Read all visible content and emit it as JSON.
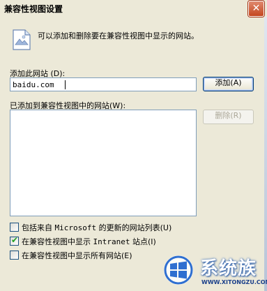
{
  "window": {
    "title": "兼容性视图设置",
    "close_glyph": "✕"
  },
  "info": {
    "text": "可以添加和删除要在兼容性视图中显示的网站。",
    "icon": "document-icon"
  },
  "add_site": {
    "label": "添加此网站",
    "label_key": "(D):",
    "value": "baidu.com",
    "button_label": "添加(A)"
  },
  "added_sites": {
    "label": "已添加到兼容性视图中的网站",
    "label_key": "(W):",
    "items": [],
    "delete_label": "删除(R)"
  },
  "options": [
    {
      "prefix": "包括来自 ",
      "mono": "Microsoft",
      "suffix": " 的更新的网站列表(U)",
      "checked": false
    },
    {
      "prefix": "在兼容性视图中显示 ",
      "mono": "Intranet",
      "suffix": " 站点(I)",
      "checked": true
    },
    {
      "prefix": "在兼容性视图中显示所有网站(E)",
      "mono": "",
      "suffix": "",
      "checked": false
    }
  ],
  "watermark": {
    "text": "系统族",
    "url": "WWW.XITONGZU.COM"
  },
  "colors": {
    "dialog_bg": "#ece9d8",
    "border_blue": "#7f9db9",
    "check_green": "#21a121"
  }
}
